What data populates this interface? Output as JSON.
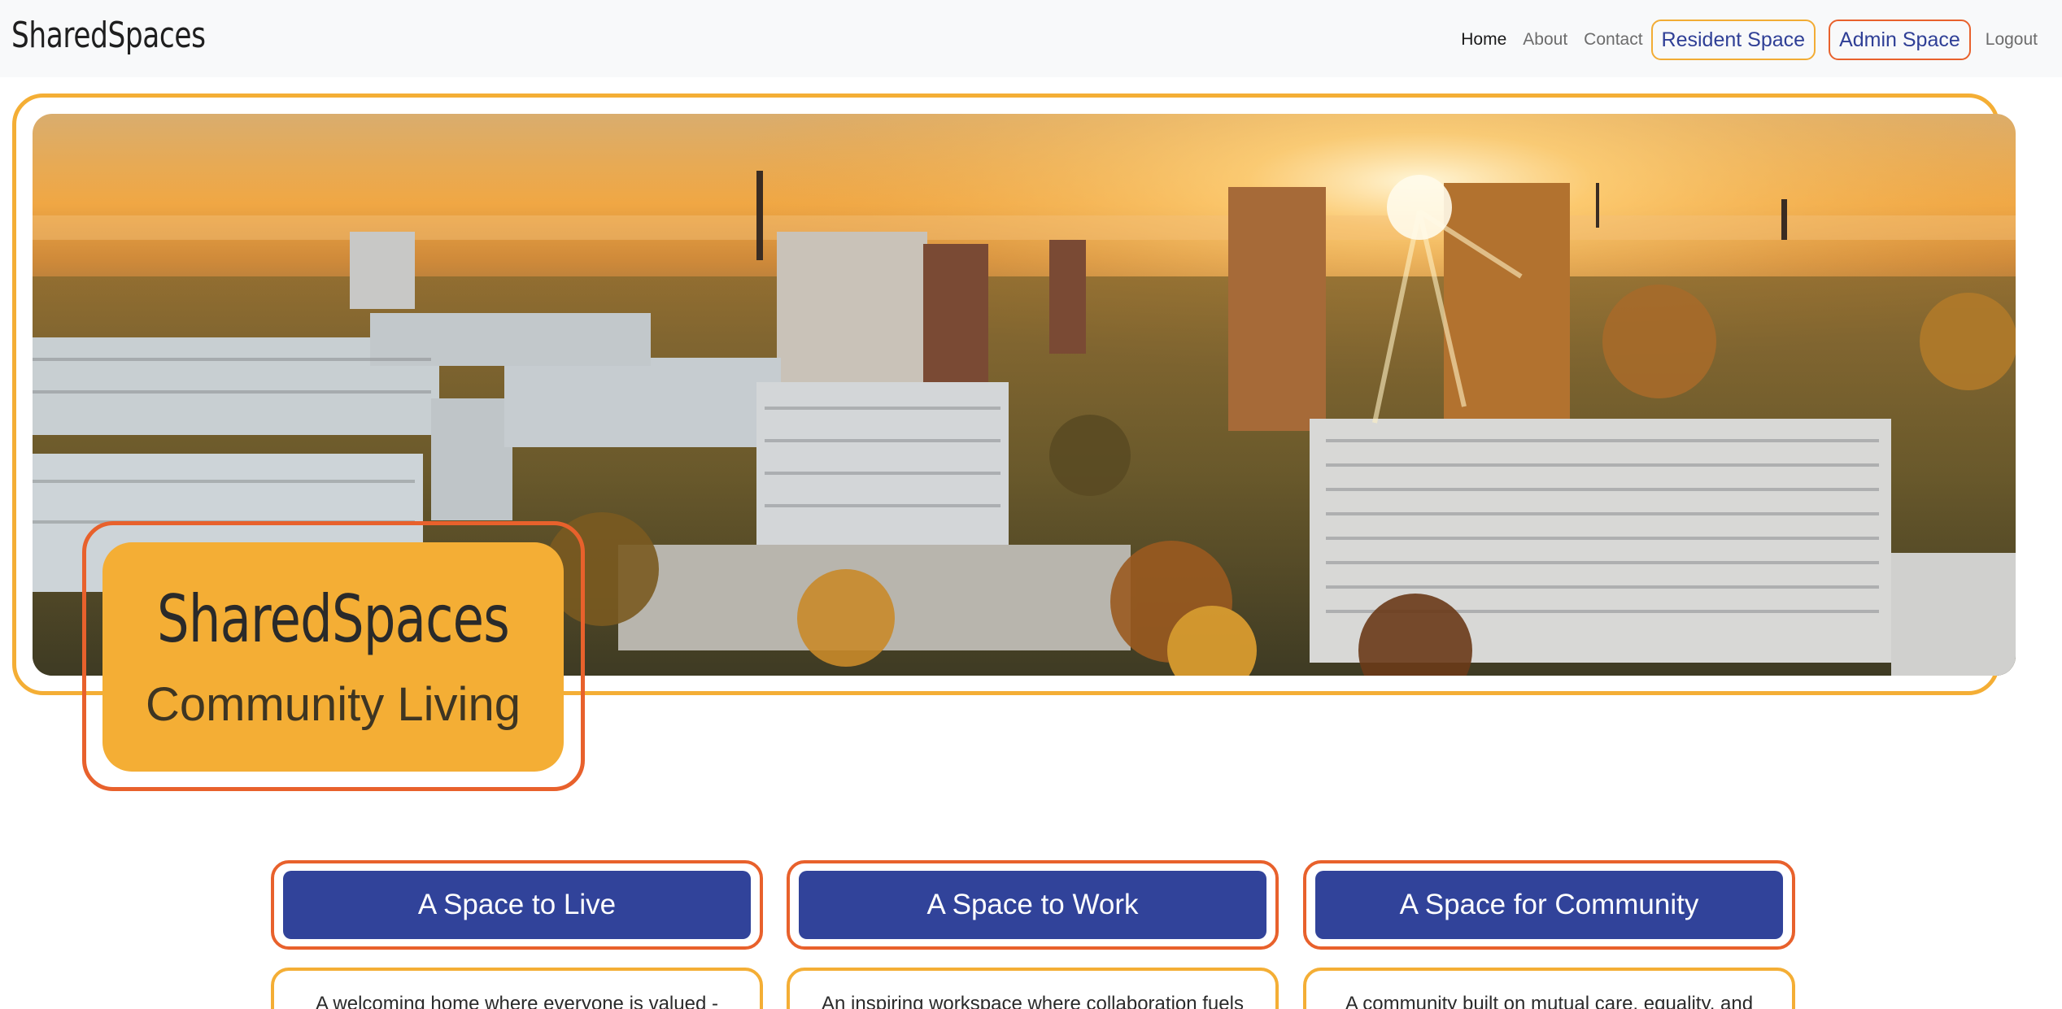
{
  "brand": "SharedSpaces",
  "nav": {
    "home": "Home",
    "about": "About",
    "contact": "Contact",
    "resident": "Resident Space",
    "admin": "Admin Space",
    "logout": "Logout"
  },
  "hero": {
    "title": "SharedSpaces",
    "subtitle": "Community Living"
  },
  "spaces": [
    {
      "label": "A Space to Live",
      "description": "A welcoming home where everyone is valued -"
    },
    {
      "label": "A Space to Work",
      "description": "An inspiring workspace where collaboration fuels"
    },
    {
      "label": "A Space for Community",
      "description": "A community built on mutual care, equality, and"
    }
  ],
  "colors": {
    "accent_orange": "#f4ae35",
    "accent_red_orange": "#e8612c",
    "primary_blue": "#31439a"
  }
}
